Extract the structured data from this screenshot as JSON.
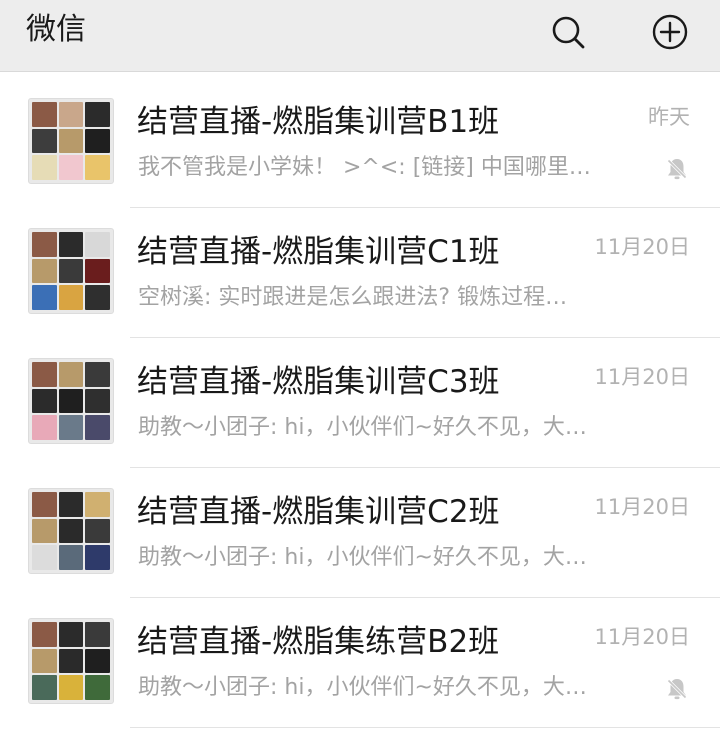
{
  "header": {
    "title": "微信",
    "icons": [
      "search-icon",
      "add-icon"
    ]
  },
  "colors": {
    "header_bg": "#ededed",
    "title_text": "#191919",
    "secondary_text": "#a3a3a3",
    "time_text": "#b2b2b2"
  },
  "chats": [
    {
      "name": "结营直播-燃脂集训营B1班",
      "time": "昨天",
      "preview": "我不管我是小学妹！ >^<: [链接] 中国哪里…",
      "muted": true,
      "avatar_palette": [
        "#8b5a46",
        "#c9a78b",
        "#2b2b2b",
        "#3d3d3d",
        "#b79a6a",
        "#1f1f1f",
        "#e6dcb6",
        "#f1c7cf",
        "#e9c46a"
      ]
    },
    {
      "name": "结营直播-燃脂集训营C1班",
      "time": "11月20日",
      "preview": "空树溪: 实时跟进是怎么跟进法? 锻炼过程…",
      "muted": false,
      "avatar_palette": [
        "#8b5a46",
        "#2b2b2b",
        "#d8d8d8",
        "#b79a6a",
        "#3a3a3a",
        "#6a1d1d",
        "#3b6fb6",
        "#d9a441",
        "#2f2f2f"
      ]
    },
    {
      "name": "结营直播-燃脂集训营C3班",
      "time": "11月20日",
      "preview": "助教～小团子: hi，小伙伴们~好久不见，大…",
      "muted": false,
      "avatar_palette": [
        "#8b5a46",
        "#b79a6a",
        "#3a3a3a",
        "#2b2b2b",
        "#1f1f1f",
        "#2f2f2f",
        "#e8a9b8",
        "#6a7a8a",
        "#4a4a6a"
      ]
    },
    {
      "name": "结营直播-燃脂集训营C2班",
      "time": "11月20日",
      "preview": "助教～小团子: hi，小伙伴们~好久不见，大…",
      "muted": false,
      "avatar_palette": [
        "#8b5a46",
        "#2b2b2b",
        "#d0b070",
        "#b79a6a",
        "#2a2a2a",
        "#3a3a3a",
        "#dcdcdc",
        "#5a6a7a",
        "#2e3a6a"
      ]
    },
    {
      "name": "结营直播-燃脂集练营B2班",
      "time": "11月20日",
      "preview": "助教～小团子: hi，小伙伴们~好久不见，大…",
      "muted": true,
      "avatar_palette": [
        "#8b5a46",
        "#2b2b2b",
        "#3a3a3a",
        "#b79a6a",
        "#2a2a2a",
        "#1f1f1f",
        "#4a6a5a",
        "#d9b23a",
        "#3f6a3a"
      ]
    }
  ]
}
